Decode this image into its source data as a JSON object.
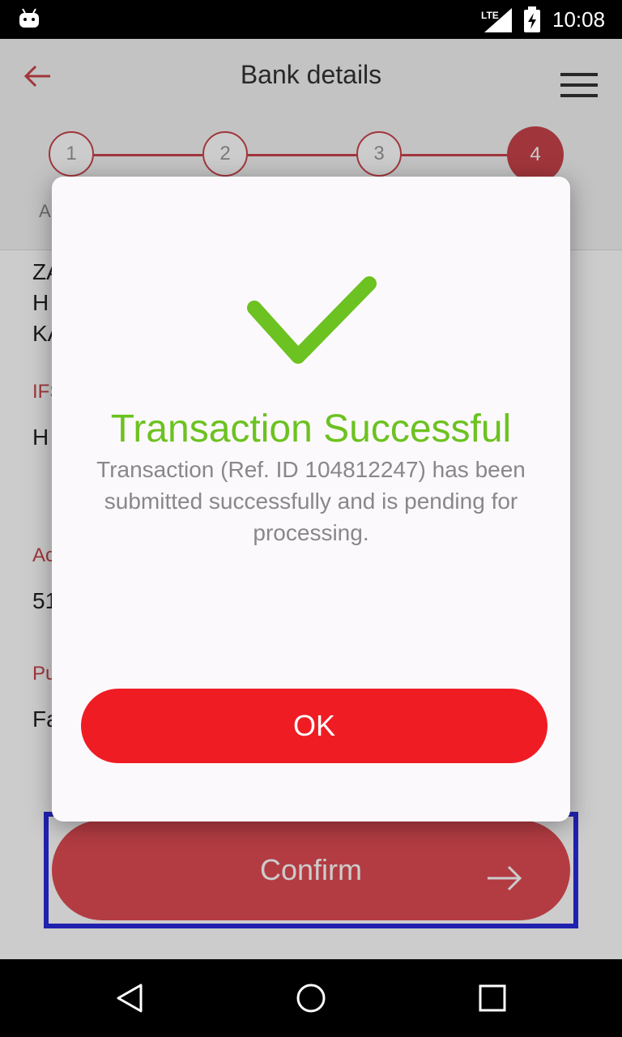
{
  "status_bar": {
    "time": "10:08",
    "network": "LTE",
    "icons": [
      "android-icon",
      "signal-icon",
      "battery-charging-icon"
    ]
  },
  "toolbar": {
    "title": "Bank details",
    "back_icon": "arrow-left-icon",
    "menu_icon": "hamburger-menu-icon"
  },
  "stepper": {
    "steps": [
      "1",
      "2",
      "3",
      "4"
    ],
    "active_step": "4"
  },
  "background_form": {
    "tab_hint": "A",
    "address_lines": [
      "ZA",
      "H",
      "KA"
    ],
    "ifsc_label": "IFS",
    "ifsc_value": "H",
    "account_label": "Ac",
    "account_value": "51",
    "purpose_label": "Pu",
    "purpose_value": "Fa"
  },
  "confirm_button": {
    "label": "Confirm",
    "icon": "arrow-right-icon"
  },
  "dialog": {
    "icon": "checkmark-icon",
    "title": "Transaction Successful",
    "message": "Transaction (Ref. ID 104812247) has been submitted successfully and is pending for processing.",
    "ok_label": "OK"
  },
  "colors": {
    "accent": "#c9444c",
    "success": "#6cc220",
    "ok_button": "#ef1c24",
    "highlight": "#2a2adc"
  }
}
